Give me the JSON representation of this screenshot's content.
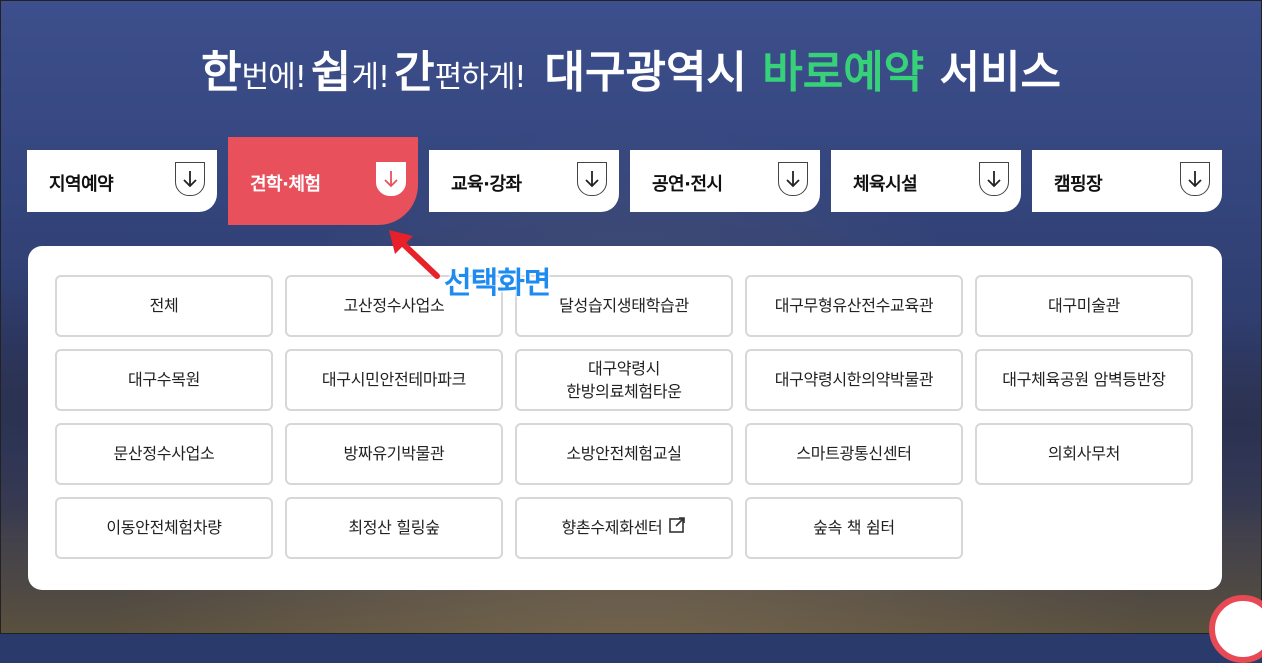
{
  "headline": {
    "part1_big": "한",
    "part1_small": "번에!",
    "part2_big": "쉽",
    "part2_small": "게!",
    "part3_big": "간",
    "part3_small": "편하게!",
    "service_prefix": "대구광역시",
    "service_accent": "바로예약",
    "service_suffix": "서비스",
    "accent_color": "#37d17a"
  },
  "tabs": [
    {
      "label": "지역예약",
      "icon": "down-arrow-icon",
      "active": false
    },
    {
      "label": "견학·체험",
      "icon": "down-arrow-icon",
      "active": true
    },
    {
      "label": "교육·강좌",
      "icon": "down-arrow-icon",
      "active": false
    },
    {
      "label": "공연·전시",
      "icon": "down-arrow-icon",
      "active": false
    },
    {
      "label": "체육시설",
      "icon": "down-arrow-icon",
      "active": false
    },
    {
      "label": "캠핑장",
      "icon": "down-arrow-icon",
      "active": false
    }
  ],
  "active_tab_color": "#e8505c",
  "annotation": {
    "text": "선택화면",
    "color": "#1d8bf0",
    "arrow_color": "#e8202a"
  },
  "items": [
    {
      "line1": "전체"
    },
    {
      "line1": "고산정수사업소"
    },
    {
      "line1": "달성습지생태학습관"
    },
    {
      "line1": "대구무형유산전수교육관"
    },
    {
      "line1": "대구미술관"
    },
    {
      "line1": "대구수목원"
    },
    {
      "line1": "대구시민안전테마파크"
    },
    {
      "line1": "대구약령시",
      "line2": "한방의료체험타운"
    },
    {
      "line1": "대구약령시한의약박물관"
    },
    {
      "line1": "대구체육공원 암벽등반장"
    },
    {
      "line1": "문산정수사업소"
    },
    {
      "line1": "방짜유기박물관"
    },
    {
      "line1": "소방안전체험교실"
    },
    {
      "line1": "스마트광통신센터"
    },
    {
      "line1": "의회사무처"
    },
    {
      "line1": "이동안전체험차량"
    },
    {
      "line1": "최정산 힐링숲"
    },
    {
      "line1": "향촌수제화센터",
      "icon": "external-link-icon"
    },
    {
      "line1": "숲속 책 쉼터"
    }
  ]
}
